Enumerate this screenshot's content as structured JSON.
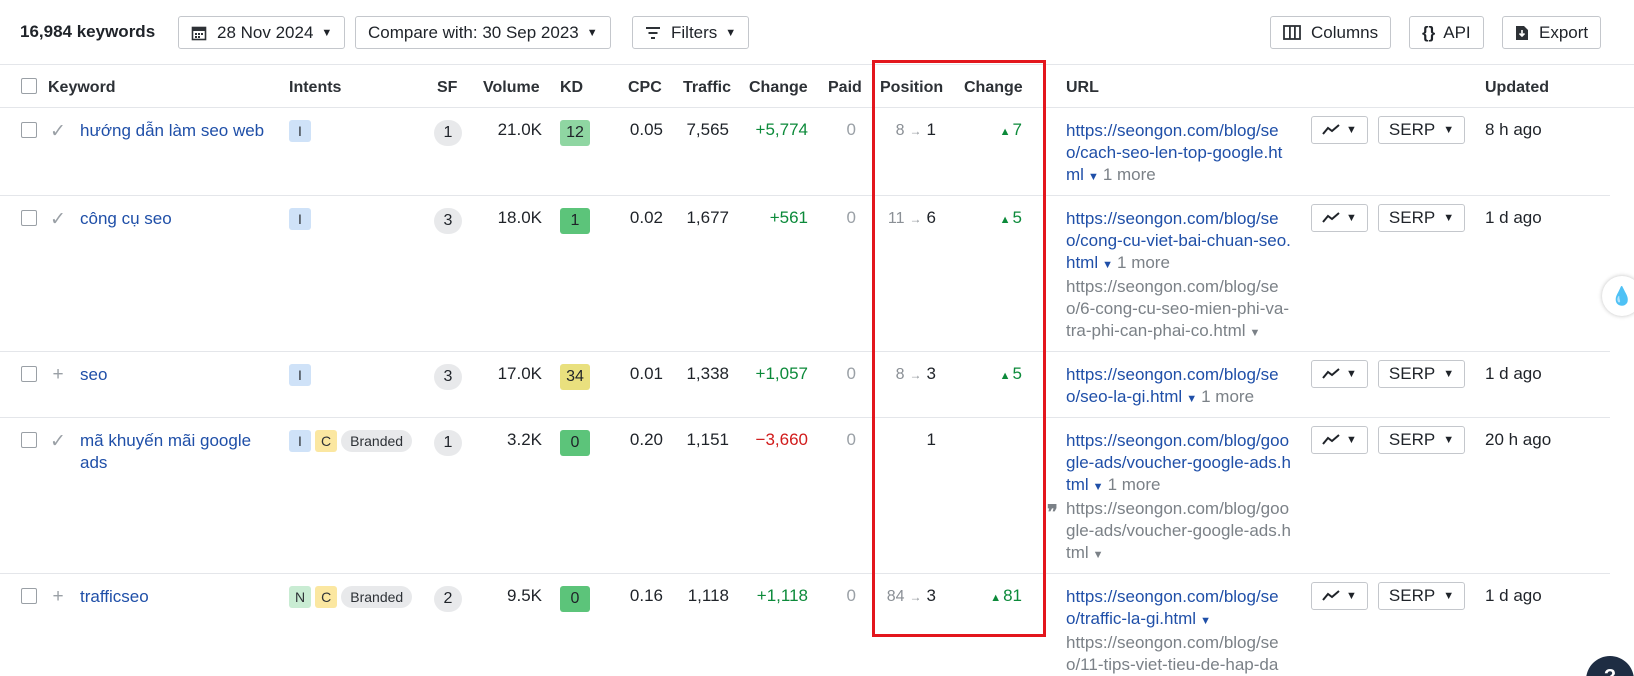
{
  "toolbar": {
    "keyword_count": "16,984 keywords",
    "date_label": "28 Nov 2024",
    "compare_label": "Compare with: 30 Sep 2023",
    "filters_label": "Filters",
    "columns_label": "Columns",
    "api_label": "API",
    "export_label": "Export"
  },
  "table": {
    "headers": {
      "keyword": "Keyword",
      "intents": "Intents",
      "sf": "SF",
      "volume": "Volume",
      "kd": "KD",
      "cpc": "CPC",
      "traffic": "Traffic",
      "change": "Change",
      "paid": "Paid",
      "position": "Position",
      "pos_change": "Change",
      "url": "URL",
      "updated": "Updated"
    },
    "rows": [
      {
        "mark": "✓",
        "keyword": "hướng dẫn làm seo web",
        "intents": [
          "I"
        ],
        "branded": "",
        "sf": "1",
        "volume": "21.0K",
        "kd": "12",
        "kd_color": "#8fd6a2",
        "cpc": "0.05",
        "traffic": "7,565",
        "change": "+5,774",
        "change_dir": "up",
        "paid": "0",
        "pos_from": "8",
        "pos_to": "1",
        "pos_change": "7",
        "url_main": "https://seongon.com/blog/seo/cach-seo-len-top-google.html",
        "url_more": "1 more",
        "url_secondary": "",
        "serp_label": "SERP",
        "updated": "8 h ago"
      },
      {
        "mark": "✓",
        "keyword": "công cụ seo",
        "intents": [
          "I"
        ],
        "branded": "",
        "sf": "3",
        "volume": "18.0K",
        "kd": "1",
        "kd_color": "#5cc47a",
        "cpc": "0.02",
        "traffic": "1,677",
        "change": "+561",
        "change_dir": "up",
        "paid": "0",
        "pos_from": "11",
        "pos_to": "6",
        "pos_change": "5",
        "url_main": "https://seongon.com/blog/seo/cong-cu-viet-bai-chuan-seo.html",
        "url_more": "1 more",
        "url_secondary": "https://seongon.com/blog/seo/6-cong-cu-seo-mien-phi-va-tra-phi-can-phai-co.html",
        "serp_label": "SERP",
        "updated": "1 d ago"
      },
      {
        "mark": "+",
        "keyword": "seo",
        "intents": [
          "I"
        ],
        "branded": "",
        "sf": "3",
        "volume": "17.0K",
        "kd": "34",
        "kd_color": "#e9e07e",
        "cpc": "0.01",
        "traffic": "1,338",
        "change": "+1,057",
        "change_dir": "up",
        "paid": "0",
        "pos_from": "8",
        "pos_to": "3",
        "pos_change": "5",
        "url_main": "https://seongon.com/blog/seo/seo-la-gi.html",
        "url_more": "1 more",
        "url_secondary": "",
        "serp_label": "SERP",
        "updated": "1 d ago"
      },
      {
        "mark": "✓",
        "keyword": "mã khuyến mãi google ads",
        "intents": [
          "I",
          "C"
        ],
        "branded": "Branded",
        "sf": "1",
        "volume": "3.2K",
        "kd": "0",
        "kd_color": "#5cc47a",
        "cpc": "0.20",
        "traffic": "1,151",
        "change": "−3,660",
        "change_dir": "down",
        "paid": "0",
        "pos_from": "",
        "pos_to": "1",
        "pos_change": "",
        "url_main": "https://seongon.com/blog/google-ads/voucher-google-ads.html",
        "url_more": "1 more",
        "url_secondary": "https://seongon.com/blog/google-ads/voucher-google-ads.html",
        "serp_label": "SERP",
        "updated": "20 h ago"
      },
      {
        "mark": "+",
        "keyword": "trafficseo",
        "intents": [
          "N",
          "C"
        ],
        "branded": "Branded",
        "sf": "2",
        "volume": "9.5K",
        "kd": "0",
        "kd_color": "#5cc47a",
        "cpc": "0.16",
        "traffic": "1,118",
        "change": "+1,118",
        "change_dir": "up",
        "paid": "0",
        "pos_from": "84",
        "pos_to": "3",
        "pos_change": "81",
        "url_main": "https://seongon.com/blog/seo/traffic-la-gi.html",
        "url_more": "",
        "url_secondary": "https://seongon.com/blog/seo/11-tips-viet-tieu-de-hap-da",
        "serp_label": "SERP",
        "updated": "1 d ago"
      }
    ]
  },
  "widgets": {
    "corner_label": "?"
  },
  "colors": {
    "link": "#1f4fa8",
    "positive": "#0c8a3a",
    "negative": "#d11b1b",
    "highlight_box": "#e3161d"
  }
}
